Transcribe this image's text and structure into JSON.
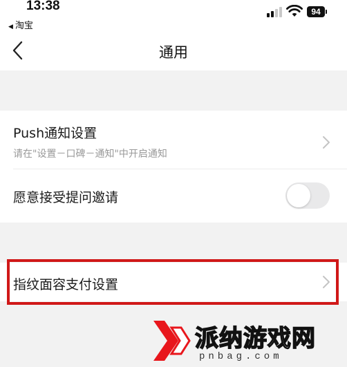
{
  "status_bar": {
    "time": "13:38",
    "back_app": "淘宝",
    "battery": "94"
  },
  "nav": {
    "title": "通用"
  },
  "settings": {
    "push": {
      "title": "Push通知设置",
      "subtitle": "请在\"设置－口碑－通知\"中开启通知"
    },
    "invite": {
      "title": "愿意接受提问邀请",
      "enabled": false
    },
    "biometric": {
      "title": "指纹面容支付设置"
    }
  },
  "watermark": {
    "title": "派纳游戏网",
    "url": "pnbag.com"
  },
  "colors": {
    "highlight": "#d01818",
    "watermark_red": "#e8161c"
  }
}
